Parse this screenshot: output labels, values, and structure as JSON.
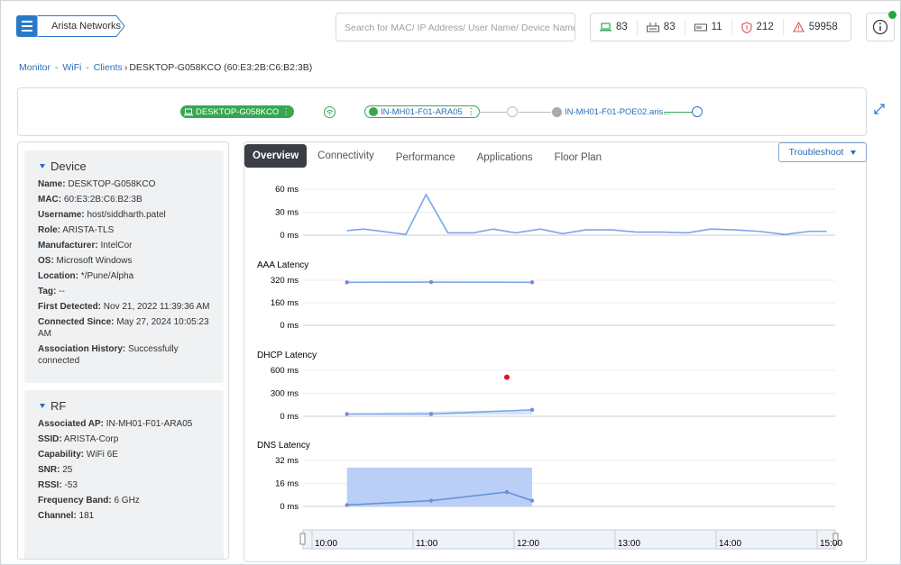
{
  "header": {
    "org_name": "Arista Networks",
    "search_placeholder": "Search for MAC/ IP Address/ User Name/ Device Name...",
    "stats": [
      {
        "icon": "laptop-icon",
        "value": "83"
      },
      {
        "icon": "switch-icon",
        "value": "83"
      },
      {
        "icon": "server-icon",
        "value": "11"
      },
      {
        "icon": "shield-icon",
        "value": "212"
      },
      {
        "icon": "warning-icon",
        "value": "59958"
      }
    ]
  },
  "breadcrumb": {
    "monitor": "Monitor",
    "wifi": "WiFi",
    "clients": "Clients",
    "current": "DESKTOP-G058KCO (60:E3:2B:C6:B2:3B)"
  },
  "topology": {
    "client": "DESKTOP-G058KCO",
    "ap": "IN-MH01-F01-ARA05",
    "switch": "IN-MH01-F01-POE02.aris..."
  },
  "device": {
    "title": "Device",
    "fields": [
      {
        "label": "Name:",
        "value": "DESKTOP-G058KCO"
      },
      {
        "label": "MAC:",
        "value": "60:E3:2B:C6:B2:3B"
      },
      {
        "label": "Username:",
        "value": "host/siddharth.patel"
      },
      {
        "label": "Role:",
        "value": "ARISTA-TLS"
      },
      {
        "label": "Manufacturer:",
        "value": "IntelCor"
      },
      {
        "label": "OS:",
        "value": "Microsoft Windows"
      },
      {
        "label": "Location:",
        "value": "*/Pune/Alpha"
      },
      {
        "label": "Tag:",
        "value": "--"
      },
      {
        "label": "First Detected:",
        "value": "Nov 21, 2022 11:39:36 AM"
      },
      {
        "label": "Connected Since:",
        "value": "May 27, 2024 10:05:23 AM"
      },
      {
        "label": "Association History:",
        "value": "Successfully connected"
      }
    ]
  },
  "rf": {
    "title": "RF",
    "fields": [
      {
        "label": "Associated AP:",
        "value": "IN-MH01-F01-ARA05"
      },
      {
        "label": "SSID:",
        "value": "ARISTA-Corp"
      },
      {
        "label": "Capability:",
        "value": "WiFi 6E"
      },
      {
        "label": "SNR:",
        "value": "25"
      },
      {
        "label": "RSSI:",
        "value": "-53"
      },
      {
        "label": "Frequency Band:",
        "value": "6 GHz"
      },
      {
        "label": "Channel:",
        "value": "181"
      }
    ]
  },
  "tabs": [
    "Overview",
    "Connectivity",
    "Performance",
    "Applications",
    "Floor Plan"
  ],
  "troubleshoot_label": "Troubleshoot",
  "colors": {
    "accent": "#2a79c9",
    "green": "#36a853",
    "series": "#7aa6e6",
    "band": "#b9cff5",
    "alert": "#e8101a"
  },
  "chart_data": [
    {
      "type": "line",
      "title": "",
      "yticks": [
        "60 ms",
        "30 ms",
        "0 ms"
      ],
      "ylim": [
        0,
        60
      ],
      "x": [
        "10:10",
        "10:20",
        "10:45",
        "10:57",
        "11:10",
        "11:25",
        "11:37",
        "11:50",
        "12:05",
        "12:18",
        "12:32",
        "12:47",
        "13:02",
        "13:17",
        "13:32",
        "13:46",
        "14:00",
        "14:15",
        "14:30",
        "14:45",
        "14:55"
      ],
      "values": [
        6,
        8,
        1,
        53,
        3,
        3,
        8,
        3,
        8,
        2,
        7,
        7,
        4,
        4,
        3,
        8,
        7,
        5,
        1,
        5,
        5
      ]
    },
    {
      "type": "line",
      "title": "AAA Latency",
      "yticks": [
        "320 ms",
        "160 ms",
        "0 ms"
      ],
      "ylim": [
        0,
        320
      ],
      "x": [
        "10:10",
        "11:00",
        "12:00"
      ],
      "values": [
        305,
        307,
        305
      ]
    },
    {
      "type": "scatter",
      "title": "DHCP Latency",
      "yticks": [
        "600 ms",
        "300 ms",
        "0 ms"
      ],
      "ylim": [
        0,
        600
      ],
      "series": [
        {
          "x": [
            "10:10",
            "11:00",
            "12:00"
          ],
          "values": [
            30,
            30,
            85
          ]
        },
        {
          "x": [
            "11:45"
          ],
          "values": [
            510
          ]
        }
      ]
    },
    {
      "type": "area",
      "title": "DNS Latency",
      "yticks": [
        "32 ms",
        "16 ms",
        "0 ms"
      ],
      "ylim": [
        0,
        32
      ],
      "band": {
        "x": [
          "10:10",
          "12:00"
        ],
        "low": 0,
        "high": 27
      },
      "x": [
        "10:10",
        "11:00",
        "11:45",
        "12:00"
      ],
      "values": [
        1,
        4,
        10,
        4
      ]
    }
  ],
  "time_axis": [
    "10:00",
    "11:00",
    "12:00",
    "13:00",
    "14:00",
    "15:00"
  ]
}
